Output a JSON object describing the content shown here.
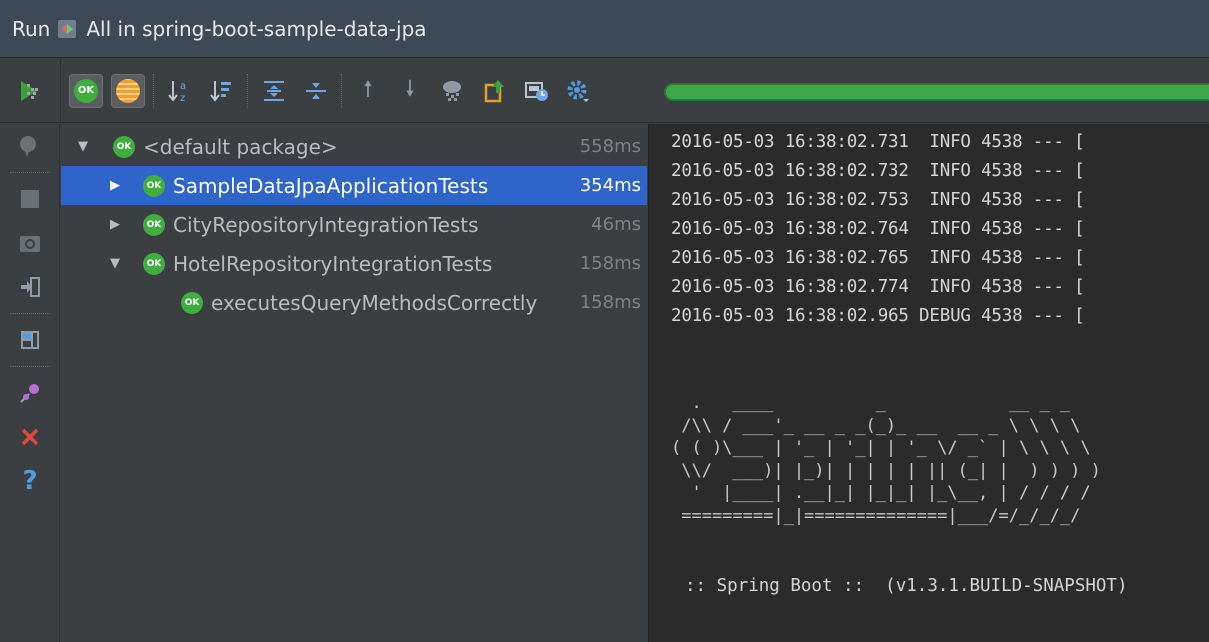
{
  "window": {
    "run_label": "Run",
    "title": "All in spring-boot-sample-data-jpa"
  },
  "toolbar": {
    "ok_label": "OK",
    "progress_fraction": 1.0,
    "progress_color": "#3fa84a",
    "icons": [
      "rerun-icon",
      "show-passed-icon",
      "show-ignored-icon",
      "sort-alpha-icon",
      "sort-duration-icon",
      "expand-all-icon",
      "collapse-all-icon",
      "previous-icon",
      "next-icon",
      "import-tests-icon",
      "export-icon",
      "history-icon",
      "settings-icon"
    ]
  },
  "side_icons": [
    "rerun-failed-icon",
    "toggle-autotest-icon",
    "stop-icon",
    "snapshot-icon",
    "exit-icon",
    "layout-icon",
    "pin-icon",
    "close-icon",
    "help-icon"
  ],
  "tree": {
    "ok_label": "OK",
    "rows": [
      {
        "label": "<default package>",
        "time": "558ms",
        "expanded": true
      },
      {
        "label": "SampleDataJpaApplicationTests",
        "time": "354ms",
        "selected": true
      },
      {
        "label": "CityRepositoryIntegrationTests",
        "time": "46ms"
      },
      {
        "label": "HotelRepositoryIntegrationTests",
        "time": "158ms",
        "expanded": true
      },
      {
        "label": "executesQueryMethodsCorrectly",
        "time": "158ms"
      }
    ]
  },
  "console": {
    "lines": [
      "2016-05-03 16:38:02.731  INFO 4538 --- [",
      "2016-05-03 16:38:02.732  INFO 4538 --- [",
      "2016-05-03 16:38:02.753  INFO 4538 --- [",
      "2016-05-03 16:38:02.764  INFO 4538 --- [",
      "2016-05-03 16:38:02.765  INFO 4538 --- [",
      "2016-05-03 16:38:02.774  INFO 4538 --- [",
      "2016-05-03 16:38:02.965 DEBUG 4538 --- ["
    ],
    "banner": "  .   ____          _            __ _ _\n /\\\\ / ___'_ __ _ _(_)_ __  __ _ \\ \\ \\ \\\n( ( )\\___ | '_ | '_| | '_ \\/ _` | \\ \\ \\ \\\n \\\\/  ___)| |_)| | | | | || (_| |  ) ) ) )\n  '  |____| .__|_| |_|_| |_\\__, | / / / /\n =========|_|==============|___/=/_/_/_/",
    "spring_boot": ":: Spring Boot ::  (v1.3.1.BUILD-SNAPSHOT)"
  }
}
